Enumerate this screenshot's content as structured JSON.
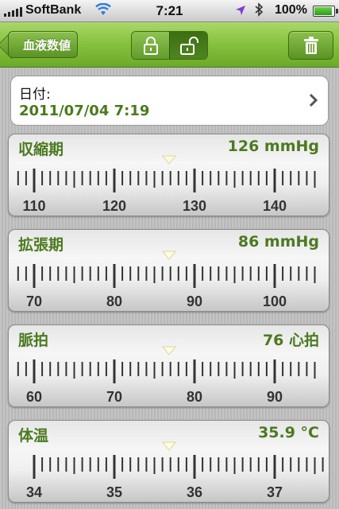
{
  "status_bar": {
    "carrier": "SoftBank",
    "time": "7:21",
    "battery": "100%",
    "battery_level": 1.0
  },
  "nav": {
    "back_label": "血液数値",
    "lock_icon": "lock-closed-icon",
    "unlock_icon": "lock-open-icon",
    "trash_icon": "trash-icon"
  },
  "date": {
    "label": "日付:",
    "value": "2011/07/04 7:19"
  },
  "colors": {
    "accent_green": "#4c7a20",
    "nav_green": "#86c13c"
  },
  "readings": [
    {
      "name": "収縮期",
      "value_text": "126 mmHg",
      "value": 126,
      "ticks": [
        110,
        120,
        130,
        140
      ],
      "range": [
        106,
        145
      ]
    },
    {
      "name": "拡張期",
      "value_text": "86 mmHg",
      "value": 86,
      "ticks": [
        70,
        80,
        90,
        100
      ],
      "range": [
        66,
        105
      ]
    },
    {
      "name": "脈拍",
      "value_text": "76 心拍",
      "value": 76,
      "ticks": [
        60,
        70,
        80,
        90
      ],
      "range": [
        56,
        95
      ]
    },
    {
      "name": "体温",
      "value_text": "35.9 °C",
      "value": 35.9,
      "ticks": [
        34,
        35,
        36,
        37
      ],
      "range": [
        34,
        37.9
      ]
    }
  ]
}
